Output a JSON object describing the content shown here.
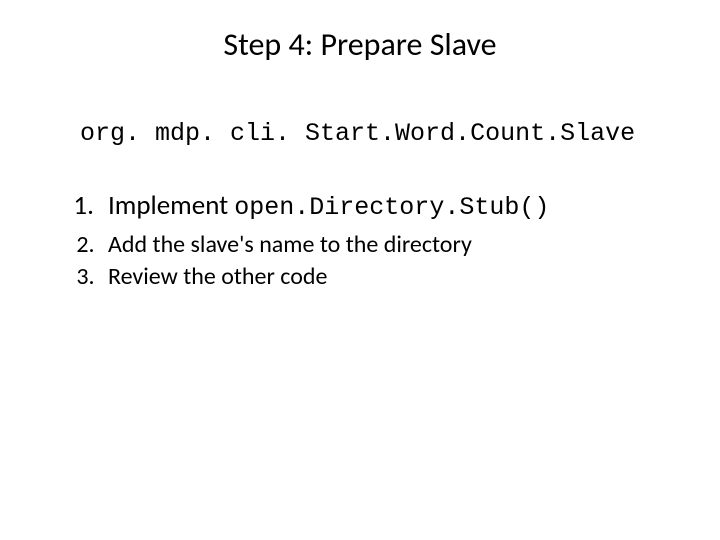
{
  "title": "Step 4: Prepare Slave",
  "className": "org. mdp. cli. Start.Word.Count.Slave",
  "items": [
    {
      "prefix": "Implement ",
      "code": "open.Directory.Stub()"
    },
    {
      "text": "Add the slave's name to the directory"
    },
    {
      "text": "Review the other code"
    }
  ]
}
